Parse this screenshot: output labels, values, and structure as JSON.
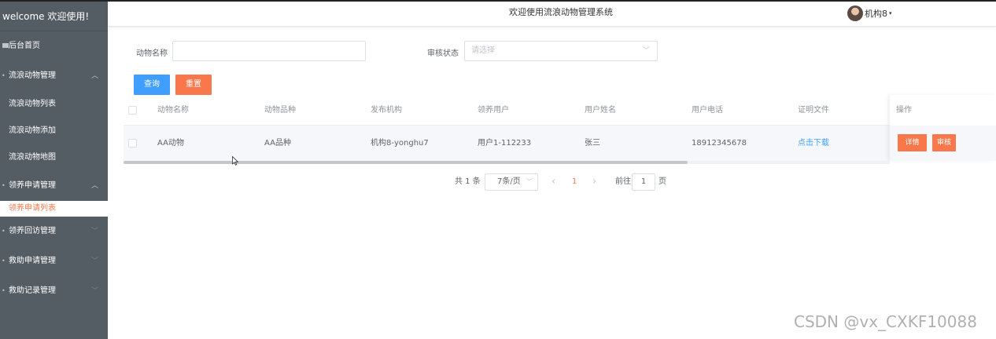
{
  "sidebar": {
    "brand": "welcome 欢迎使用!",
    "home": "后台首页",
    "groups": [
      {
        "label": "流浪动物管理",
        "expanded": true,
        "children": [
          "流浪动物列表",
          "流浪动物添加",
          "流浪动物地图"
        ]
      },
      {
        "label": "领养申请管理",
        "expanded": true,
        "children": [
          "领养申请列表"
        ]
      },
      {
        "label": "领养回访管理",
        "expanded": false
      },
      {
        "label": "救助申请管理",
        "expanded": false
      },
      {
        "label": "救助记录管理",
        "expanded": false
      }
    ],
    "active_item": "领养申请列表"
  },
  "header": {
    "title": "欢迎使用流浪动物管理系统",
    "user": "机构8",
    "caret": "▾"
  },
  "filter": {
    "name_label": "动物名称",
    "name_value": "",
    "status_label": "审核状态",
    "status_placeholder": "请选择",
    "query_button": "查询",
    "reset_button": "重置"
  },
  "table": {
    "columns": [
      "动物名称",
      "动物品种",
      "发布机构",
      "领养用户",
      "用户姓名",
      "用户电话",
      "证明文件",
      "操作"
    ],
    "rows": [
      {
        "animal_name": "AA动物",
        "breed": "AA品种",
        "org": "机构8-yonghu7",
        "user": "用户1-112233",
        "real_name": "张三",
        "phone": "18912345678",
        "file": "点击下载",
        "actions": [
          "详情",
          "审核"
        ]
      }
    ]
  },
  "pagination": {
    "total": "共 1 条",
    "page_size": "7条/页",
    "prev": "‹",
    "current": "1",
    "next": "›",
    "goto_label": "前往",
    "goto_value": "1",
    "page_unit": "页"
  },
  "watermark": "CSDN @vx_CXKF10088",
  "colors": {
    "sidebar_bg": "#545c64",
    "primary": "#409eff",
    "accent": "#f8784c",
    "active_text": "#f07a4c"
  }
}
